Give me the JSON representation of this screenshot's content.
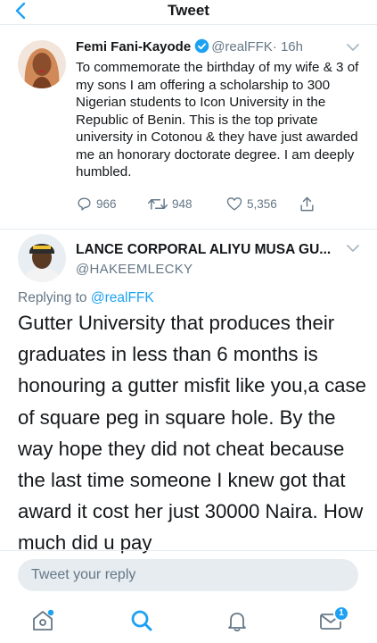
{
  "header": {
    "title": "Tweet",
    "back_icon": "chevron-left-icon"
  },
  "quoted_tweet": {
    "author_name": "Femi Fani-Kayode",
    "verified": true,
    "handle": "@realFFK",
    "time": "· 16h",
    "text": "To commemorate the birthday of my wife & 3 of my sons I am offering a scholarship to 300 Nigerian students to Icon University in the Republic of Benin. This is the top private university in Cotonou & they have just awarded me an honorary doctorate degree. I am deeply humbled.",
    "replies": "966",
    "retweets": "948",
    "likes": "5,356"
  },
  "reply_tweet": {
    "author_name": "LANCE CORPORAL ALIYU MUSA GU...",
    "handle": "@HAKEEMLECKY",
    "replying_prefix": "Replying to",
    "replying_to": "@realFFK",
    "text": "Gutter University that produces their graduates in less than 6 months is honouring a gutter misfit like you,a case of square peg in square hole. By the way hope they did not cheat because the last time someone I knew got that award it cost her just 30000 Naira. How much did u pay"
  },
  "composer": {
    "placeholder": "Tweet your reply"
  },
  "tabbar": {
    "items": [
      "home-icon",
      "search-icon",
      "notifications-icon",
      "messages-icon"
    ],
    "messages_badge": "1"
  },
  "colors": {
    "accent": "#1da1f2",
    "secondary_text": "#657786",
    "divider": "#e6ecf0"
  }
}
